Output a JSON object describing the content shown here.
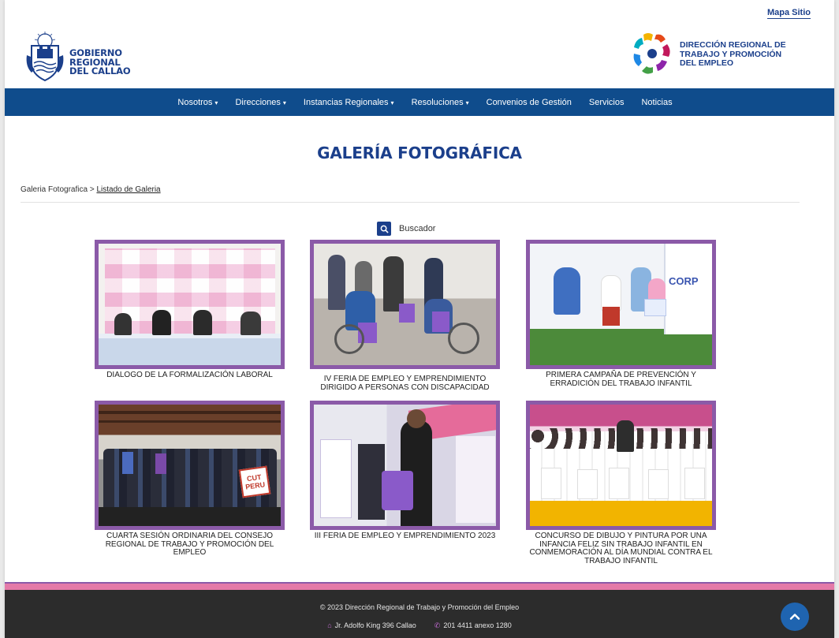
{
  "header": {
    "mapa_sitio": "Mapa Sitio",
    "gobierno": [
      "GOBIERNO",
      "REGIONAL",
      "DEL CALLAO"
    ],
    "direccion": [
      "DIRECCIÓN REGIONAL DE",
      "TRABAJO Y PROMOCIÓN",
      "DEL EMPLEO"
    ]
  },
  "nav": {
    "items": [
      {
        "label": "Nosotros",
        "dropdown": true
      },
      {
        "label": "Direcciones",
        "dropdown": true
      },
      {
        "label": "Instancias Regionales",
        "dropdown": true
      },
      {
        "label": "Resoluciones",
        "dropdown": true
      },
      {
        "label": "Convenios de Gestión",
        "dropdown": false
      },
      {
        "label": "Servicios",
        "dropdown": false
      },
      {
        "label": "Noticias",
        "dropdown": false
      }
    ]
  },
  "page": {
    "title": "GALERÍA FOTOGRÁFICA",
    "breadcrumb_root": "Galeria Fotografica",
    "breadcrumb_sep": ">",
    "breadcrumb_current": "Listado de Galeria",
    "search_label": "Buscador"
  },
  "gallery": [
    {
      "caption": "DIALOGO DE LA FORMALIZACIÓN LABORAL"
    },
    {
      "caption": "IV FERIA DE EMPLEO Y EMPRENDIMIENTO DIRIGIDO A PERSONAS CON DISCAPACIDAD"
    },
    {
      "caption": "PRIMERA CAMPAÑA DE PREVENCIÓN Y ERRADICIÓN DEL TRABAJO INFANTIL"
    },
    {
      "caption": "CUARTA SESIÓN ORDINARIA DEL CONSEJO REGIONAL DE TRABAJO Y PROMOCIÓN DEL EMPLEO"
    },
    {
      "caption": "III FERIA DE EMPLEO Y EMPRENDIMIENTO 2023"
    },
    {
      "caption": "CONCURSO DE DIBUJO Y PINTURA POR UNA INFANCIA FELIZ SIN TRABAJO INFANTIL EN CONMEMORACIÓN AL DÍA MUNDIAL CONTRA EL TRABAJO INFANTIL"
    }
  ],
  "footer": {
    "copyright": "© 2023 Dirección Regional de Trabajo y Promoción del Empleo",
    "address": "Jr. Adolfo King 396 Callao",
    "phone": "201 4411 anexo 1280"
  },
  "colors": {
    "brand_blue": "#0f4c8c",
    "title_blue": "#1b3f8b",
    "frame_purple": "#8b5aa8",
    "footer_pink": "#e47aa8",
    "footer_dark": "#2c2c2c"
  },
  "icons": {
    "search": "search-icon",
    "home": "home-icon",
    "phone": "phone-icon",
    "back_to_top": "chevron-up-icon"
  }
}
